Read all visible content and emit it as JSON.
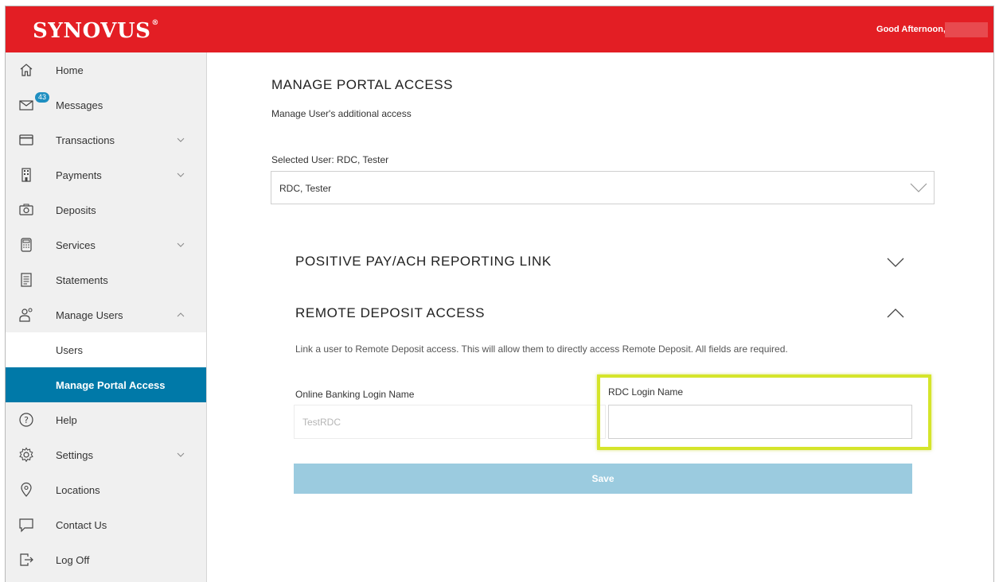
{
  "header": {
    "logo": "SYNOVUS",
    "greeting": "Good Afternoon,",
    "brand_color": "#e31e24"
  },
  "sidebar": {
    "items": [
      {
        "label": "Home",
        "icon": "home-icon"
      },
      {
        "label": "Messages",
        "icon": "envelope-icon",
        "badge": "43"
      },
      {
        "label": "Transactions",
        "icon": "credit-card-icon",
        "chevron": "down"
      },
      {
        "label": "Payments",
        "icon": "building-icon",
        "chevron": "down"
      },
      {
        "label": "Deposits",
        "icon": "camera-icon"
      },
      {
        "label": "Services",
        "icon": "calculator-icon",
        "chevron": "down"
      },
      {
        "label": "Statements",
        "icon": "document-icon"
      },
      {
        "label": "Manage Users",
        "icon": "users-icon",
        "chevron": "up"
      }
    ],
    "subitems": [
      {
        "label": "Users"
      },
      {
        "label": "Manage Portal Access",
        "active": true
      }
    ],
    "items_after": [
      {
        "label": "Help",
        "icon": "question-icon"
      },
      {
        "label": "Settings",
        "icon": "gear-icon",
        "chevron": "down"
      },
      {
        "label": "Locations",
        "icon": "map-pin-icon"
      },
      {
        "label": "Contact Us",
        "icon": "chat-icon"
      },
      {
        "label": "Log Off",
        "icon": "logout-icon"
      }
    ]
  },
  "main": {
    "title": "MANAGE PORTAL ACCESS",
    "subtitle": "Manage User's additional access",
    "selected_user_label": "Selected User: RDC, Tester",
    "selected_user_value": "RDC, Tester",
    "sections": {
      "positive_pay": {
        "title": "POSITIVE PAY/ACH REPORTING LINK",
        "expanded": false
      },
      "remote_deposit": {
        "title": "REMOTE DEPOSIT ACCESS",
        "expanded": true,
        "description": "Link a user to Remote Deposit access. This will allow them to directly access Remote Deposit. All fields are required.",
        "online_login_label": "Online Banking Login Name",
        "online_login_value": "TestRDC",
        "rdc_login_label": "RDC Login Name",
        "rdc_login_value": "",
        "save_label": "Save"
      }
    }
  }
}
